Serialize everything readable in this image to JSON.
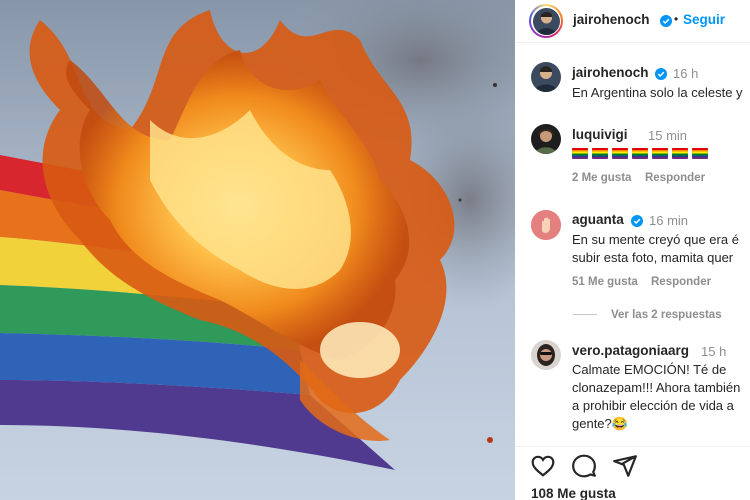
{
  "post": {
    "author": "jairohenoch",
    "follow_label": "Seguir",
    "separator": "•",
    "caption": {
      "username": "jairohenoch",
      "time": "16 h",
      "text": "En Argentina solo la celeste y"
    },
    "likes": "108 Me gusta"
  },
  "comments": [
    {
      "username": "luquivigi",
      "time": "15 min",
      "flag_count": 7,
      "likes": "2 Me gusta",
      "reply_label": "Responder"
    },
    {
      "username": "aguanta",
      "time": "16 min",
      "lines": [
        "En su mente creyó que era é",
        "subir esta foto, mamita quer"
      ],
      "likes": "51 Me gusta",
      "reply_label": "Responder",
      "view_replies": "Ver las 2 respuestas"
    },
    {
      "username": "vero.patagoniaarg",
      "time": "15 h",
      "lines": [
        "Calmate EMOCIÓN! Té de",
        "clonazepam!!! Ahora también",
        "a prohibir elección de vida a",
        "gente?😂"
      ]
    }
  ],
  "icons": [
    "heart-icon",
    "comment-icon",
    "share-icon",
    "verified-icon"
  ],
  "colors": {
    "link": "#0095f6",
    "verified": "#0095f6",
    "muted": "#8e8e8e"
  }
}
